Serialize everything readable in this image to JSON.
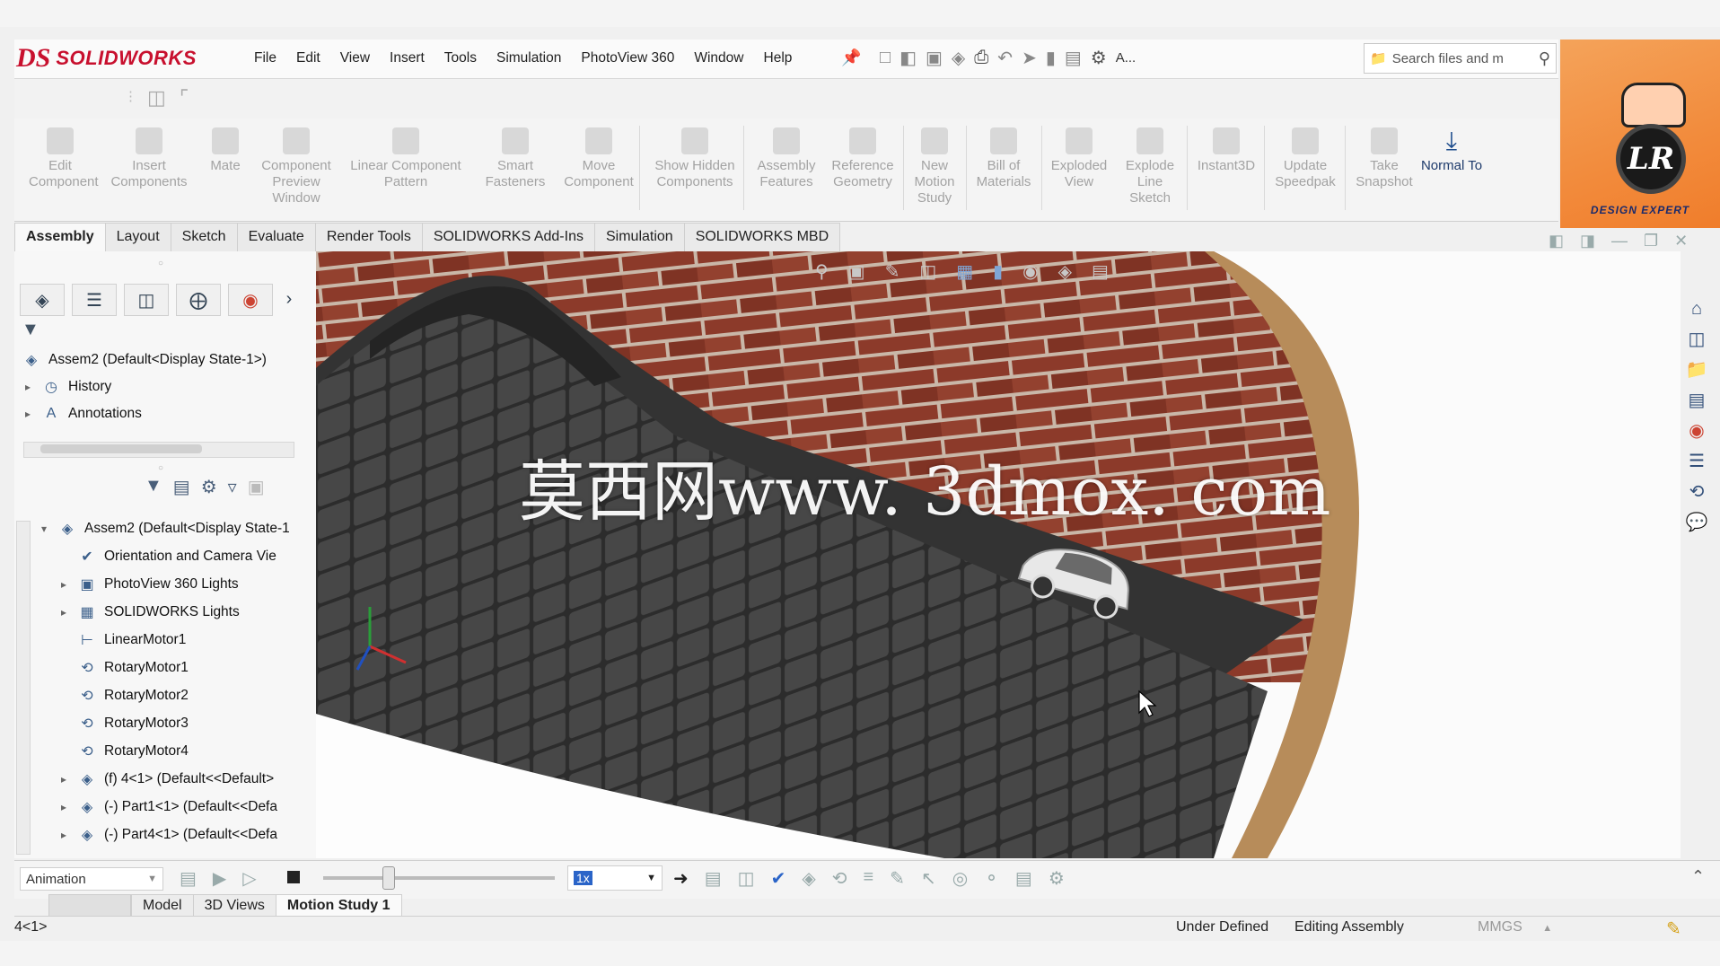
{
  "app": {
    "logo_ds": "DS",
    "logo_name": "SOLIDWORKS"
  },
  "menu": [
    "File",
    "Edit",
    "View",
    "Insert",
    "Tools",
    "Simulation",
    "PhotoView 360",
    "Window",
    "Help"
  ],
  "quick_truncated": "A...",
  "search": {
    "placeholder": "Search files and m"
  },
  "ribbon": [
    {
      "label": "Edit Component"
    },
    {
      "label": "Insert Components"
    },
    {
      "label": "Mate"
    },
    {
      "label": "Component Preview Window"
    },
    {
      "label": "Linear Component Pattern"
    },
    {
      "label": "Smart Fasteners"
    },
    {
      "label": "Move Component"
    },
    {
      "label": "Show Hidden Components"
    },
    {
      "label": "Assembly Features"
    },
    {
      "label": "Reference Geometry"
    },
    {
      "label": "New Motion Study"
    },
    {
      "label": "Bill of Materials"
    },
    {
      "label": "Exploded View"
    },
    {
      "label": "Explode Line Sketch"
    },
    {
      "label": "Instant3D"
    },
    {
      "label": "Update Speedpak"
    },
    {
      "label": "Take Snapshot"
    },
    {
      "label": "Normal To"
    }
  ],
  "command_tabs": [
    "Assembly",
    "Layout",
    "Sketch",
    "Evaluate",
    "Render Tools",
    "SOLIDWORKS Add-Ins",
    "Simulation",
    "SOLIDWORKS MBD"
  ],
  "brand": {
    "text": "DESIGN EXPERT",
    "mono": "LR"
  },
  "tree_top": [
    {
      "label": "Assem2  (Default<Display State-1>)"
    },
    {
      "label": "History"
    },
    {
      "label": "Annotations"
    }
  ],
  "tree_main": [
    {
      "label": "Assem2  (Default<Display State-1"
    },
    {
      "label": "Orientation and Camera Vie"
    },
    {
      "label": "PhotoView 360 Lights"
    },
    {
      "label": "SOLIDWORKS Lights"
    },
    {
      "label": "LinearMotor1"
    },
    {
      "label": "RotaryMotor1"
    },
    {
      "label": "RotaryMotor2"
    },
    {
      "label": "RotaryMotor3"
    },
    {
      "label": "RotaryMotor4"
    },
    {
      "label": "(f) 4<1> (Default<<Default>"
    },
    {
      "label": "(-) Part1<1> (Default<<Defa"
    },
    {
      "label": "(-) Part4<1> (Default<<Defa"
    }
  ],
  "watermark": "莫西网www. 3dmox. com",
  "motion": {
    "type": "Animation",
    "speed": "1x"
  },
  "bottom_tabs": [
    "Model",
    "3D Views",
    "Motion Study 1"
  ],
  "status": {
    "left": "4<1>",
    "defined": "Under Defined",
    "mode": "Editing Assembly",
    "units": "MMGS"
  },
  "colors": {
    "brick": "#8c3a2a",
    "mortar": "#c9b7a8",
    "asphalt": "#3b3b3b",
    "accent": "#c8102e"
  }
}
